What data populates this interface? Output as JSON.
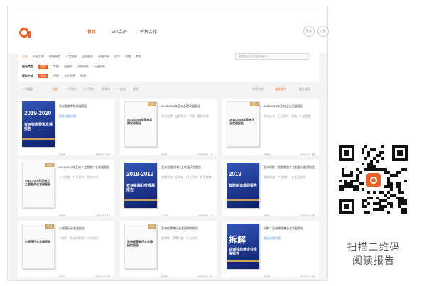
{
  "nav": {
    "home": "首页",
    "vip": "VIP会员",
    "coop": "开放合作"
  },
  "header": {
    "circle1": "登录",
    "circle2": "注册"
  },
  "search": {
    "placeholder": "搜索报告名称或关键词"
  },
  "filters": {
    "row1": [
      "全部",
      "产业互联",
      "智能制造",
      "人工智能",
      "企业服务",
      "金融科技",
      "医疗",
      "消费",
      "其他"
    ],
    "row2_label": "报告类型",
    "row2": [
      "全部",
      "专题",
      "白皮书",
      "案例研究",
      "行业研究"
    ],
    "row3_label": "获取方式",
    "row3": [
      "全部",
      "付费",
      "会员免费",
      "免费"
    ]
  },
  "sortbar": {
    "result": "47份报告",
    "items": [
      "全部",
      "一个月内",
      "三个月内",
      "半年内",
      "一年内",
      "更早"
    ],
    "right_label": "排序方式:",
    "right_active": "最新发布",
    "right_other": "最多阅读"
  },
  "cards": [
    {
      "title": "亚洲智能零售发展报告",
      "sub": "报告详细内容",
      "sub_link": true,
      "downloads": "3256",
      "date": "2019-01-20",
      "cover": "blue",
      "cover_year": "2019-2020",
      "cover_title": "亚洲智能零售发展报告"
    },
    {
      "title": "2018-2019年亚洲品牌发展报告",
      "sub": "亚洲品牌 · 品牌研究 · 中国 · 投资布局",
      "downloads": "3021",
      "date": "2019-01-18",
      "cover": "white",
      "cover_tag": "报告",
      "cover_title": "2018-2019年亚洲品牌发展报告"
    },
    {
      "title": "2018-2019年亚洲企业发展报告",
      "sub": "亚洲企业 · 企业研究 · 科技 · 人工智能",
      "downloads": "2968",
      "date": "2019-01-15",
      "cover": "white",
      "cover_tag": "报告",
      "cover_title": "2018-2019年亚洲企业发展报告"
    },
    {
      "title": "2018-2019年亚洲人工智能产业发展报告",
      "sub": "人工智能 · 产业研究 · 亚洲市场",
      "downloads": "2834",
      "date": "2019-01-12",
      "cover": "white",
      "cover_tag": "报告",
      "cover_title": "2018-2019年亚洲人工智能产业发展报告"
    },
    {
      "title": "亚洲金融科技行业发展研究报告",
      "sub": "金融科技 · 区块链 · 行业研究 · 投资趋势",
      "downloads": "2715",
      "date": "2019-01-10",
      "cover": "blue",
      "cover_year": "2018-2019",
      "cover_title": "亚洲金融科技发展报告"
    },
    {
      "title": "亚洲科技：智能制造产业发展与展望报告",
      "sub": "智能制造 · 产业研究 · 工业互联网",
      "downloads": "2603",
      "date": "2019-01-08",
      "cover": "blue",
      "cover_year": "2019",
      "cover_title": "智能制造发展报告"
    },
    {
      "title": "小程序行业发展报告",
      "sub": "小程序 · 移动互联网 · 行业研究",
      "downloads": "2487",
      "date": "2019-01-06",
      "cover": "white",
      "cover_tag": "报告",
      "cover_title": "小程序行业发展报告"
    },
    {
      "title": "亚洲新零售行业发展研究报告",
      "sub": "新零售 · 消费升级 · 行业研究",
      "downloads": "2359",
      "date": "2019-01-04",
      "cover": "white",
      "cover_tag": "报告",
      "cover_title": "亚洲新零售行业发展研究报告"
    },
    {
      "title": "拆解：亚洲独角兽企业发展报告",
      "sub": "报告详细内容",
      "sub_link": true,
      "downloads": "2248",
      "date": "2019-01-02",
      "cover": "blue",
      "cover_big": "拆解",
      "cover_title": "亚洲独角兽企业发展报告"
    }
  ],
  "qr": {
    "caption_line1": "扫描二维码",
    "caption_line2": "阅读报告"
  },
  "colors": {
    "accent": "#e8622a",
    "gold": "#c9a15b",
    "cover_blue": "#1c3590"
  }
}
